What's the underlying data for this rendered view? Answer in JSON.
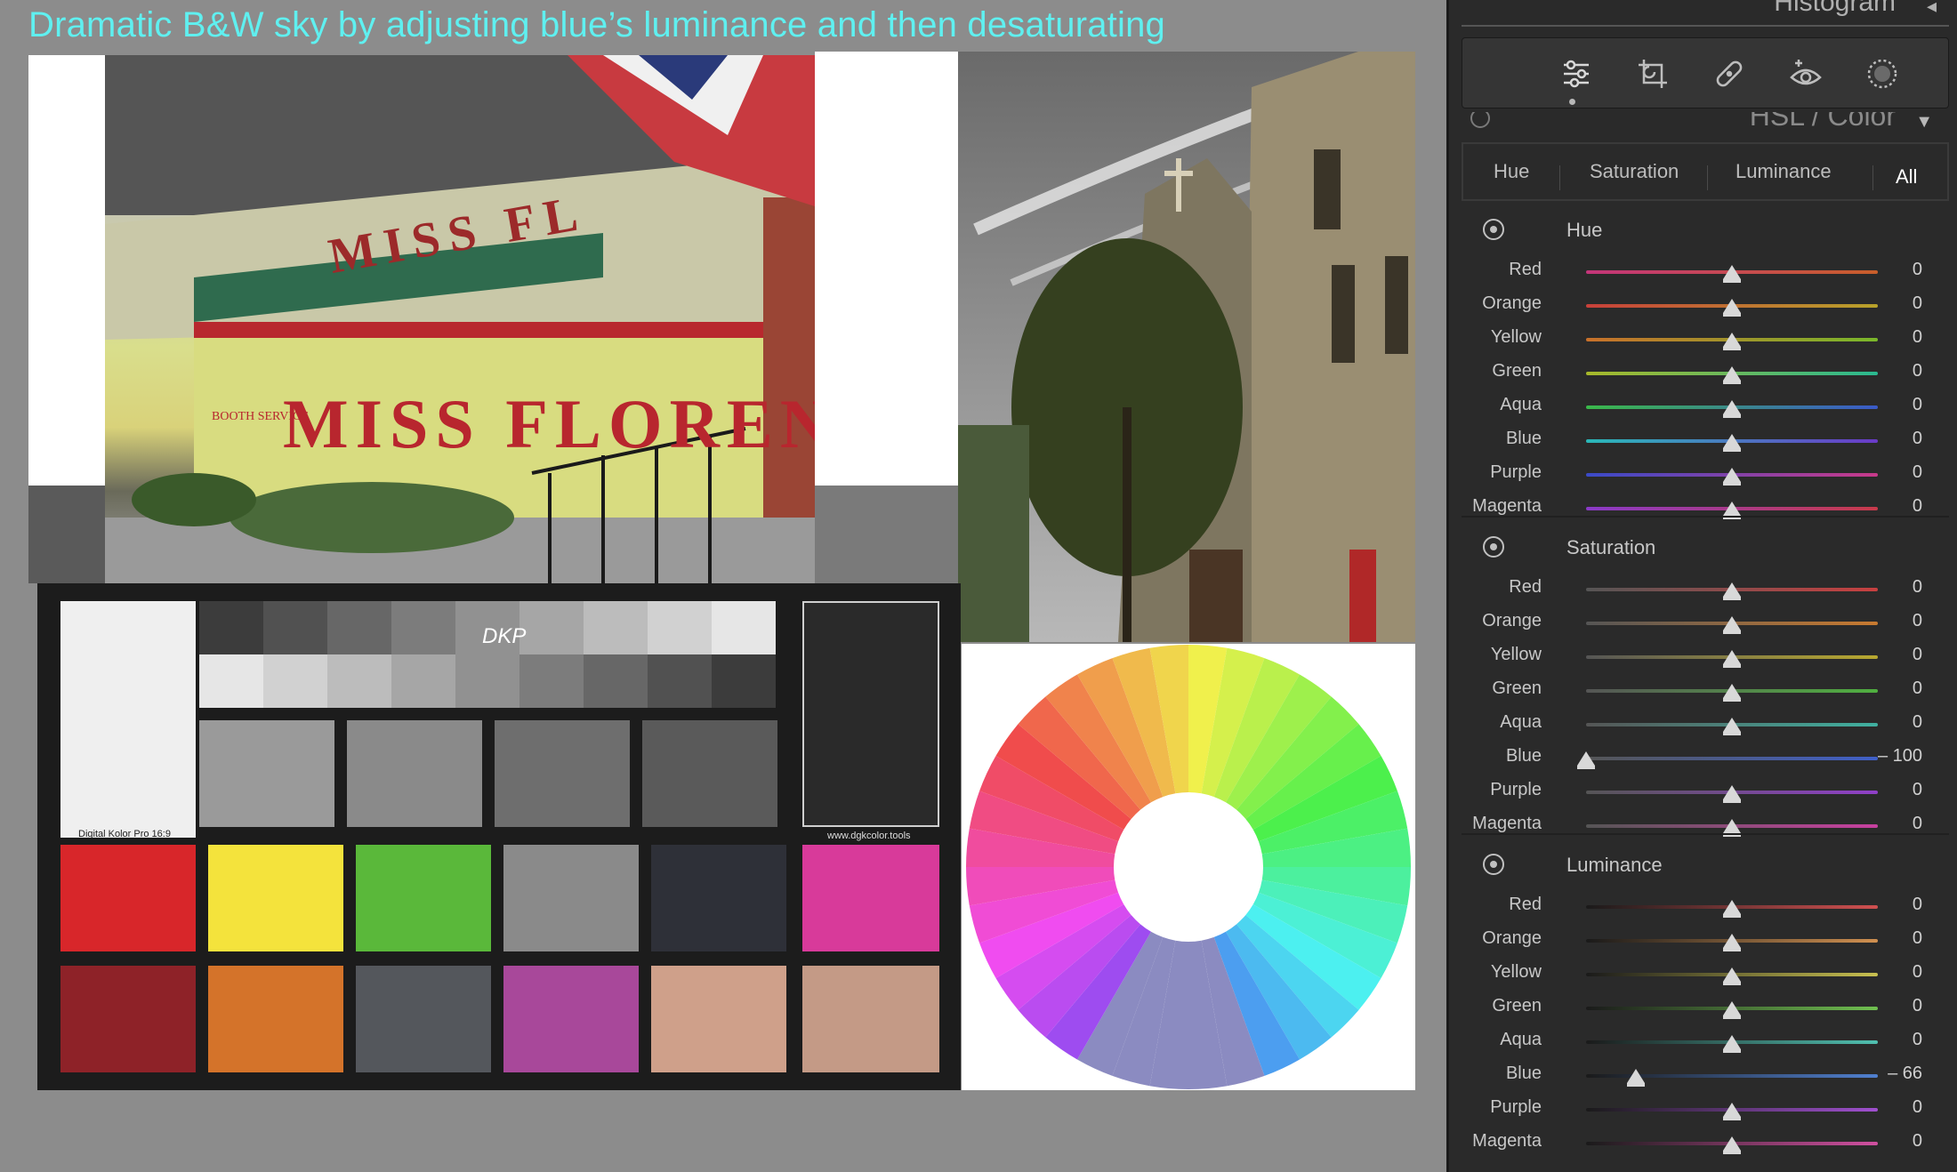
{
  "caption": "Dramatic B&W sky by adjusting blue’s luminance and then desaturating",
  "images": {
    "diner_sign_top": "MISS FL",
    "diner_sign": "MISS FLORENC",
    "diner_booth": "BOOTH SERVICE",
    "checker_brand": "Digital Kolor Pro 16:9",
    "checker_url": "www.dgkcolor.tools",
    "checker_logo": "DKP"
  },
  "panel": {
    "histogram_title": "Histogram",
    "hsl_title": "HSL / Color",
    "tools": [
      {
        "name": "edit-sliders-icon"
      },
      {
        "name": "crop-icon"
      },
      {
        "name": "healing-icon"
      },
      {
        "name": "red-eye-icon"
      },
      {
        "name": "masking-icon"
      }
    ],
    "tabs": [
      "Hue",
      "Saturation",
      "Luminance",
      "All"
    ],
    "active_tab": "All"
  },
  "sections": [
    {
      "title": "Hue",
      "rows": [
        {
          "label": "Red",
          "value": "0",
          "level": 0,
          "gradient": [
            "#c4357a",
            "#c85e2a"
          ]
        },
        {
          "label": "Orange",
          "value": "0",
          "level": 0,
          "gradient": [
            "#c8403a",
            "#b8a22a"
          ]
        },
        {
          "label": "Yellow",
          "value": "0",
          "level": 0,
          "gradient": [
            "#c8702a",
            "#7ab82a"
          ]
        },
        {
          "label": "Green",
          "value": "0",
          "level": 0,
          "gradient": [
            "#a8b82a",
            "#2ab890"
          ]
        },
        {
          "label": "Aqua",
          "value": "0",
          "level": 0,
          "gradient": [
            "#3ab84a",
            "#3a5ac8"
          ]
        },
        {
          "label": "Blue",
          "value": "0",
          "level": 0,
          "gradient": [
            "#2ab8b8",
            "#6a3ac8"
          ]
        },
        {
          "label": "Purple",
          "value": "0",
          "level": 0,
          "gradient": [
            "#3a4ac8",
            "#c83a8a"
          ]
        },
        {
          "label": "Magenta",
          "value": "0",
          "level": 0,
          "gradient": [
            "#8a3ac8",
            "#c83a4a"
          ]
        }
      ]
    },
    {
      "title": "Saturation",
      "rows": [
        {
          "label": "Red",
          "value": "0",
          "level": 0,
          "gradient": [
            "#555555",
            "#c84040"
          ]
        },
        {
          "label": "Orange",
          "value": "0",
          "level": 0,
          "gradient": [
            "#555555",
            "#c87a30"
          ]
        },
        {
          "label": "Yellow",
          "value": "0",
          "level": 0,
          "gradient": [
            "#555555",
            "#b8a830"
          ]
        },
        {
          "label": "Green",
          "value": "0",
          "level": 0,
          "gradient": [
            "#555555",
            "#50b040"
          ]
        },
        {
          "label": "Aqua",
          "value": "0",
          "level": 0,
          "gradient": [
            "#555555",
            "#40b0a0"
          ]
        },
        {
          "label": "Blue",
          "value": "– 100",
          "level": -100,
          "gradient": [
            "#555555",
            "#4060c8"
          ]
        },
        {
          "label": "Purple",
          "value": "0",
          "level": 0,
          "gradient": [
            "#555555",
            "#9040c8"
          ]
        },
        {
          "label": "Magenta",
          "value": "0",
          "level": 0,
          "gradient": [
            "#555555",
            "#c840a0"
          ]
        }
      ]
    },
    {
      "title": "Luminance",
      "rows": [
        {
          "label": "Red",
          "value": "0",
          "level": 0,
          "gradient": [
            "#1a1a1a",
            "#d05050"
          ]
        },
        {
          "label": "Orange",
          "value": "0",
          "level": 0,
          "gradient": [
            "#1a1a1a",
            "#d09050"
          ]
        },
        {
          "label": "Yellow",
          "value": "0",
          "level": 0,
          "gradient": [
            "#1a1a1a",
            "#c8c050"
          ]
        },
        {
          "label": "Green",
          "value": "0",
          "level": 0,
          "gradient": [
            "#1a1a1a",
            "#70c050"
          ]
        },
        {
          "label": "Aqua",
          "value": "0",
          "level": 0,
          "gradient": [
            "#1a1a1a",
            "#50c0b0"
          ]
        },
        {
          "label": "Blue",
          "value": "– 66",
          "level": -66,
          "gradient": [
            "#1a1a1a",
            "#5080d0"
          ]
        },
        {
          "label": "Purple",
          "value": "0",
          "level": 0,
          "gradient": [
            "#1a1a1a",
            "#a050d0"
          ]
        },
        {
          "label": "Magenta",
          "value": "0",
          "level": 0,
          "gradient": [
            "#1a1a1a",
            "#d050a0"
          ]
        }
      ]
    }
  ]
}
